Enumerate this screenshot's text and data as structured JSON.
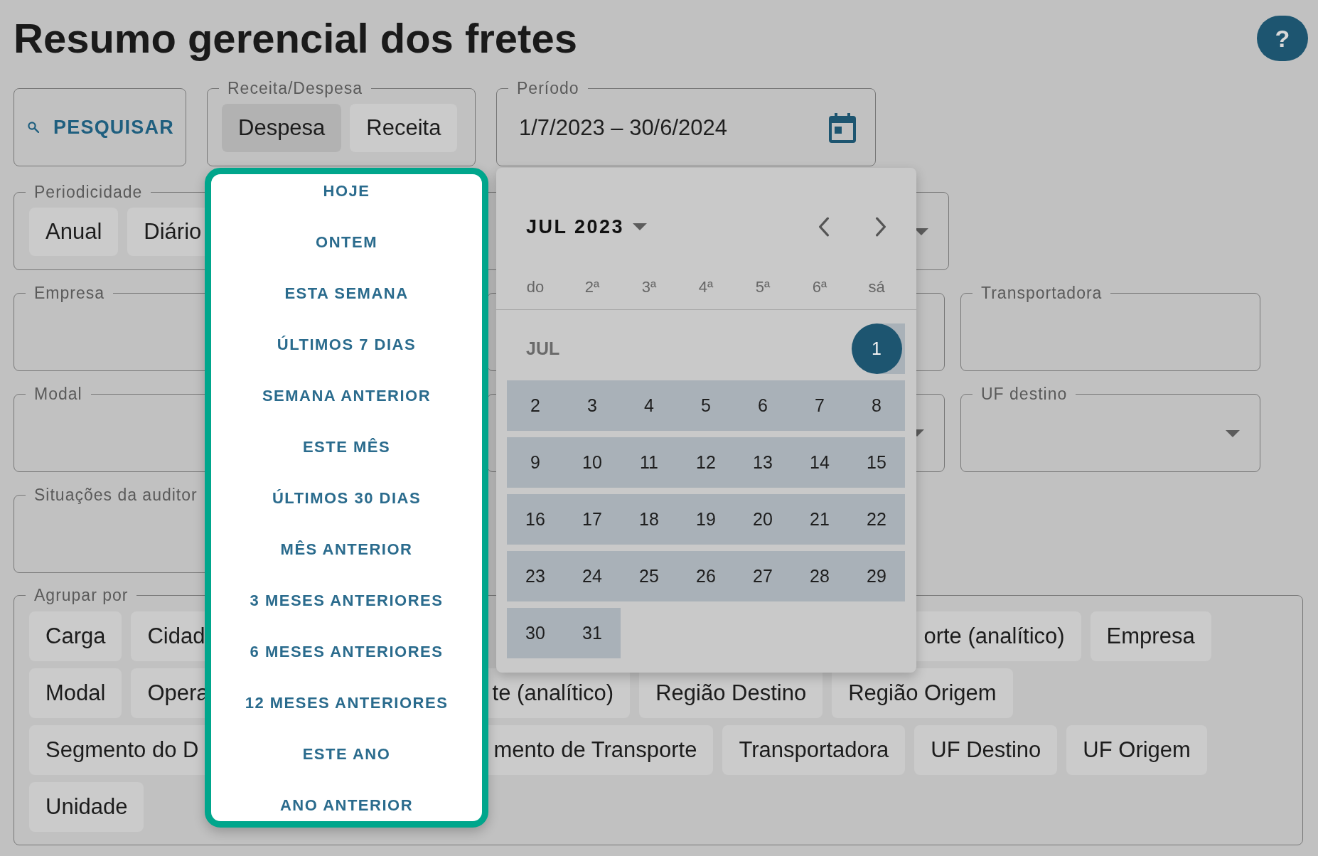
{
  "header": {
    "title": "Resumo gerencial dos fretes",
    "help_label": "?"
  },
  "search_button": {
    "label": "PESQUISAR"
  },
  "receita_despesa": {
    "legend": "Receita/Despesa",
    "options": [
      {
        "label": "Despesa",
        "selected": true
      },
      {
        "label": "Receita",
        "selected": false
      }
    ]
  },
  "periodo": {
    "legend": "Período",
    "value": "1/7/2023 – 30/6/2024"
  },
  "periodicidade": {
    "legend": "Periodicidade",
    "kind": "select",
    "options": [
      {
        "label": "Anual",
        "selected": false
      },
      {
        "label": "Diário",
        "selected": false
      }
    ]
  },
  "fields": [
    {
      "label": "Empresa",
      "kind": "text"
    },
    {
      "kind": "text"
    },
    {
      "label": "Transportadora",
      "kind": "text"
    },
    {
      "label": "Modal",
      "kind": "text"
    },
    {
      "kind": "select"
    },
    {
      "label": "UF destino",
      "kind": "select"
    },
    {
      "label": "Situações da auditor",
      "kind": "text"
    }
  ],
  "group_by": {
    "legend": "Agrupar por",
    "rows": [
      {
        "options": [
          {
            "label": "Carga",
            "selected": false
          },
          {
            "label": "Cidad",
            "selected": false
          },
          {
            "label": "orte (analítico)",
            "selected": false
          },
          {
            "label": "Empresa",
            "selected": false
          }
        ]
      },
      {
        "options": [
          {
            "label": "Modal",
            "selected": false
          },
          {
            "label": "Opera",
            "selected": false
          },
          {
            "label": "te (analítico)",
            "selected": false
          },
          {
            "label": "Região Destino",
            "selected": false
          },
          {
            "label": "Região Origem",
            "selected": false
          }
        ]
      },
      {
        "options": [
          {
            "label": "Segmento do D",
            "selected": false
          },
          {
            "label": "mento de Transporte",
            "selected": false
          },
          {
            "label": "Transportadora",
            "selected": false
          },
          {
            "label": "UF Destino",
            "selected": false
          },
          {
            "label": "UF Origem",
            "selected": false
          }
        ]
      },
      {
        "options": [
          {
            "label": "Unidade",
            "selected": false
          }
        ]
      }
    ]
  },
  "date_presets": [
    "HOJE",
    "ONTEM",
    "ESTA SEMANA",
    "ÚLTIMOS 7 DIAS",
    "SEMANA ANTERIOR",
    "ESTE MÊS",
    "ÚLTIMOS 30 DIAS",
    "MÊS ANTERIOR",
    "3 MESES ANTERIORES",
    "6 MESES ANTERIORES",
    "12 MESES ANTERIORES",
    "ESTE ANO",
    "ANO ANTERIOR"
  ],
  "calendar": {
    "month_year": "JUL 2023",
    "weekdays": [
      "do",
      "2ª",
      "3ª",
      "4ª",
      "5ª",
      "6ª",
      "sá"
    ],
    "month_label": "JUL",
    "weeks": [
      {
        "days": [
          {
            "day": "1",
            "selected": true,
            "in_range": true
          }
        ]
      },
      {
        "days": [
          {
            "day": "2",
            "selected": false,
            "in_range": true
          },
          {
            "day": "3",
            "selected": false,
            "in_range": true
          },
          {
            "day": "4",
            "selected": false,
            "in_range": true
          },
          {
            "day": "5",
            "selected": false,
            "in_range": true
          },
          {
            "day": "6",
            "selected": false,
            "in_range": true
          },
          {
            "day": "7",
            "selected": false,
            "in_range": true
          },
          {
            "day": "8",
            "selected": false,
            "in_range": true
          }
        ]
      },
      {
        "days": [
          {
            "day": "9",
            "selected": false,
            "in_range": true
          },
          {
            "day": "10",
            "selected": false,
            "in_range": true
          },
          {
            "day": "11",
            "selected": false,
            "in_range": true
          },
          {
            "day": "12",
            "selected": false,
            "in_range": true
          },
          {
            "day": "13",
            "selected": false,
            "in_range": true
          },
          {
            "day": "14",
            "selected": false,
            "in_range": true
          },
          {
            "day": "15",
            "selected": false,
            "in_range": true
          }
        ]
      },
      {
        "days": [
          {
            "day": "16",
            "selected": false,
            "in_range": true
          },
          {
            "day": "17",
            "selected": false,
            "in_range": true
          },
          {
            "day": "18",
            "selected": false,
            "in_range": true
          },
          {
            "day": "19",
            "selected": false,
            "in_range": true
          },
          {
            "day": "20",
            "selected": false,
            "in_range": true
          },
          {
            "day": "21",
            "selected": false,
            "in_range": true
          },
          {
            "day": "22",
            "selected": false,
            "in_range": true
          }
        ]
      },
      {
        "days": [
          {
            "day": "23",
            "selected": false,
            "in_range": true
          },
          {
            "day": "24",
            "selected": false,
            "in_range": true
          },
          {
            "day": "25",
            "selected": false,
            "in_range": true
          },
          {
            "day": "26",
            "selected": false,
            "in_range": true
          },
          {
            "day": "27",
            "selected": false,
            "in_range": true
          },
          {
            "day": "28",
            "selected": false,
            "in_range": true
          },
          {
            "day": "29",
            "selected": false,
            "in_range": true
          }
        ]
      },
      {
        "days": [
          {
            "day": "30",
            "selected": false,
            "in_range": true
          },
          {
            "day": "31",
            "selected": false,
            "in_range": true
          }
        ]
      }
    ]
  }
}
